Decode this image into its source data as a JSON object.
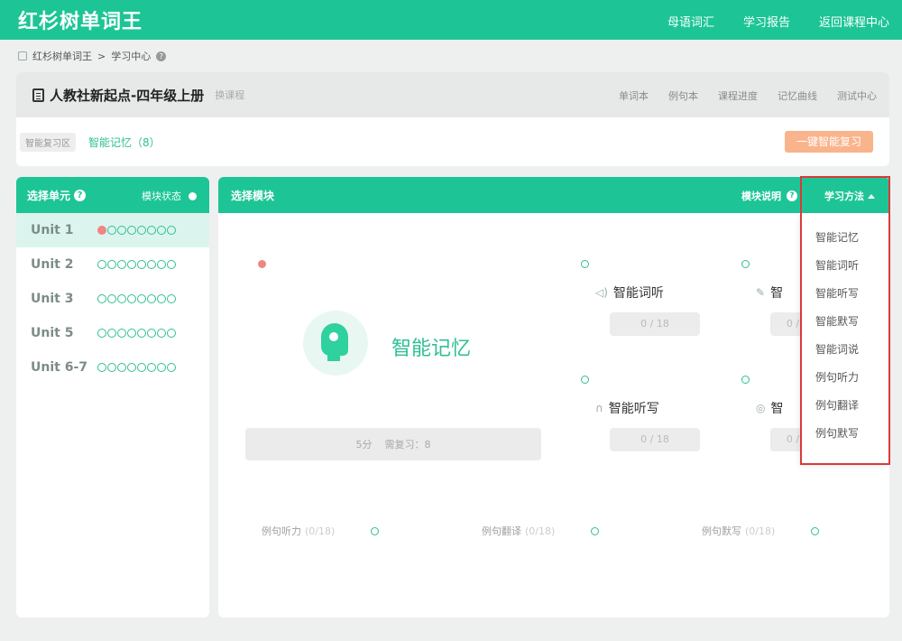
{
  "header": {
    "brand": "红杉树单词王",
    "nav": [
      "母语词汇",
      "学习报告",
      "返回课程中心"
    ]
  },
  "breadcrumb": {
    "root": "红杉树单词王",
    "sep": ">",
    "current": "学习中心"
  },
  "course": {
    "title": "人教社新起点-四年级上册",
    "switch_label": "换课程",
    "tools": [
      "单词本",
      "例句本",
      "课程进度",
      "记忆曲线",
      "测试中心"
    ],
    "tag": "智能复习区",
    "review_label": "智能记忆（8）",
    "review_button": "一键智能复习"
  },
  "units_panel": {
    "title": "选择单元",
    "status_label": "模块状态",
    "units": [
      {
        "name": "Unit 1",
        "active": true
      },
      {
        "name": "Unit 2",
        "active": false
      },
      {
        "name": "Unit 3",
        "active": false
      },
      {
        "name": "Unit 5",
        "active": false
      },
      {
        "name": "Unit 6-7",
        "active": false
      }
    ]
  },
  "modules_panel": {
    "title": "选择模块",
    "explain_label": "模块说明",
    "method_label": "学习方法",
    "featured": {
      "title": "智能记忆",
      "score": "5分",
      "review": "需复习：8"
    },
    "cards": [
      {
        "label": "智能词听",
        "progress": "0 / 18",
        "icon": "speaker-icon"
      },
      {
        "label": "智",
        "progress": "0 /",
        "icon": "pencil-icon"
      },
      {
        "label": "智能听写",
        "progress": "0 / 18",
        "icon": "headphones-icon"
      },
      {
        "label": "智",
        "progress": "0 /",
        "icon": "mic-icon"
      }
    ],
    "sentence_modules": [
      {
        "label": "例句听力",
        "count": "(0/18)"
      },
      {
        "label": "例句翻译",
        "count": "(0/18)"
      },
      {
        "label": "例句默写",
        "count": "(0/18)"
      }
    ]
  },
  "method_dropdown": {
    "items": [
      "智能记忆",
      "智能词听",
      "智能听写",
      "智能默写",
      "智能词说",
      "例句听力",
      "例句翻译",
      "例句默写"
    ]
  },
  "colors": {
    "accent": "#1dc596",
    "warning": "#f08585",
    "highlight": "#d93a3a",
    "orange": "#f9b48c"
  }
}
